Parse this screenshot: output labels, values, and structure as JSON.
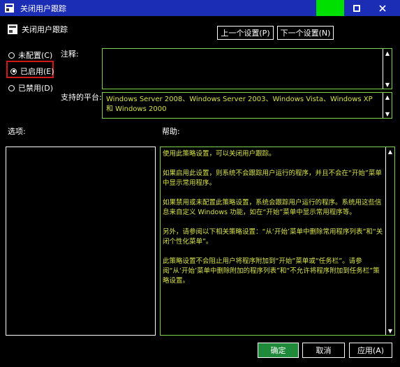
{
  "window": {
    "title": "关闭用户跟踪",
    "accent_color": "#00e000",
    "titlebar_color": "#1c2db5"
  },
  "header": {
    "title": "关闭用户跟踪",
    "prev_label": "上一个设置(P)",
    "next_label": "下一个设置(N)"
  },
  "state": {
    "options": [
      {
        "label": "未配置(C)",
        "selected": false
      },
      {
        "label": "已启用(E)",
        "selected": true
      },
      {
        "label": "已禁用(D)",
        "selected": false
      }
    ]
  },
  "comment": {
    "label": "注释:",
    "value": ""
  },
  "platform": {
    "label": "支持的平台:",
    "value": "Windows Server 2008、Windows Server 2003、Windows Vista、Windows XP 和 Windows 2000"
  },
  "options_section": {
    "label": "选项:"
  },
  "help_section": {
    "label": "帮助:",
    "paragraphs": [
      "使用此策略设置，可以关闭用户跟踪。",
      "如果启用此设置，则系统不会跟踪用户运行的程序，并且不会在“开始”菜单中显示常用程序。",
      "如果禁用或未配置此策略设置，系统会跟踪用户运行的程序。系统用这些信息来自定义 Windows 功能，如在“开始”菜单中显示常用程序等。",
      "另外，请参阅以下相关策略设置：“从‘开始’菜单中删除常用程序列表”和“关闭个性化菜单”。",
      "此策略设置不会阻止用户将程序附加到“开始”菜单或“任务栏”。请参阅“从‘开始’菜单中删除附加的程序列表”和“不允许将程序附加到任务栏”策略设置。"
    ]
  },
  "footer": {
    "ok_label": "确定",
    "cancel_label": "取消",
    "apply_label": "应用(A)",
    "ok_color": "#1e8a3a"
  },
  "icons": {
    "window_icon": "policy-icon",
    "header_icon": "policy-icon",
    "maximize": "maximize-icon",
    "close": "close-icon",
    "scroll_up": "scroll-up-icon",
    "scroll_down": "scroll-down-icon"
  }
}
